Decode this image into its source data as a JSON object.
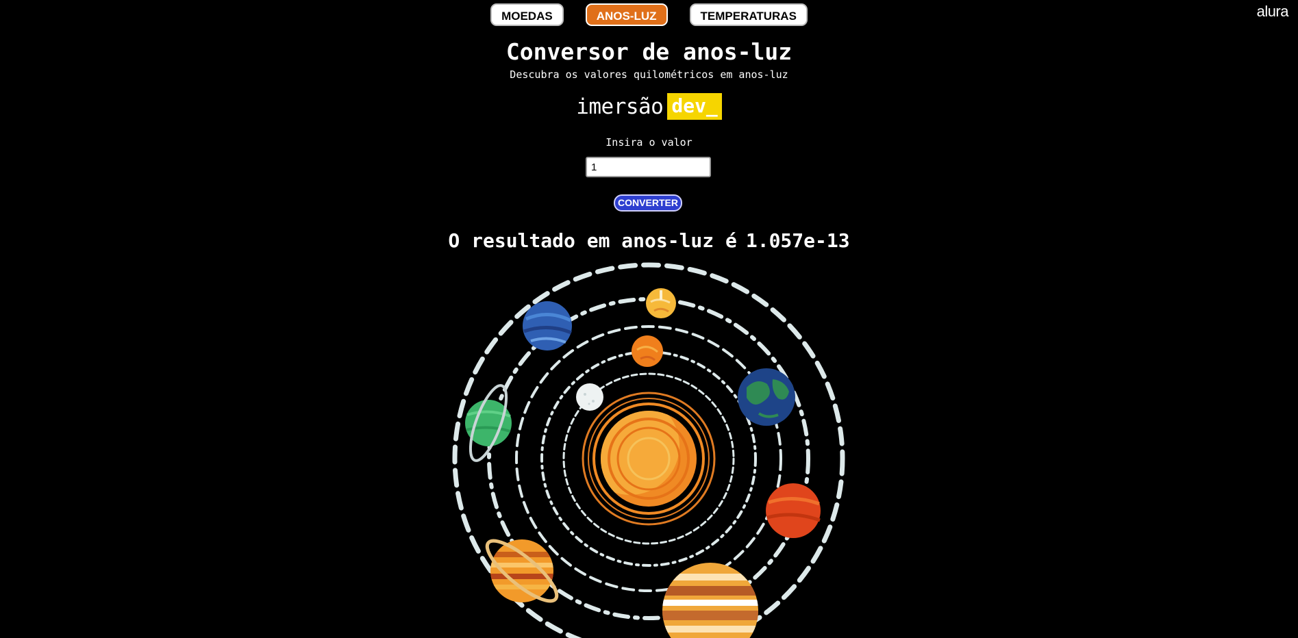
{
  "nav": {
    "items": [
      {
        "label": "MOEDAS",
        "active": false
      },
      {
        "label": "ANOS-LUZ",
        "active": true
      },
      {
        "label": "TEMPERATURAS",
        "active": false
      }
    ]
  },
  "logo": {
    "text": "alura"
  },
  "header": {
    "title": "Conversor de anos-luz",
    "subtitle": "Descubra os valores quilométricos em anos-luz"
  },
  "brand": {
    "word": "imersão",
    "highlight": "dev_"
  },
  "form": {
    "label": "Insira o valor",
    "input_value": "1",
    "button_label": "CONVERTER"
  },
  "result": {
    "prefix": "O resultado em anos-luz é",
    "value": "1.057e-13"
  },
  "illustration": {
    "icon": "solar-system-illustration",
    "colors": {
      "sun": "#f08a24",
      "orbit": "#dde9ea",
      "accent": "#e0701a",
      "brand_yellow": "#f6d500",
      "button_blue": "#2e3fd0"
    }
  }
}
